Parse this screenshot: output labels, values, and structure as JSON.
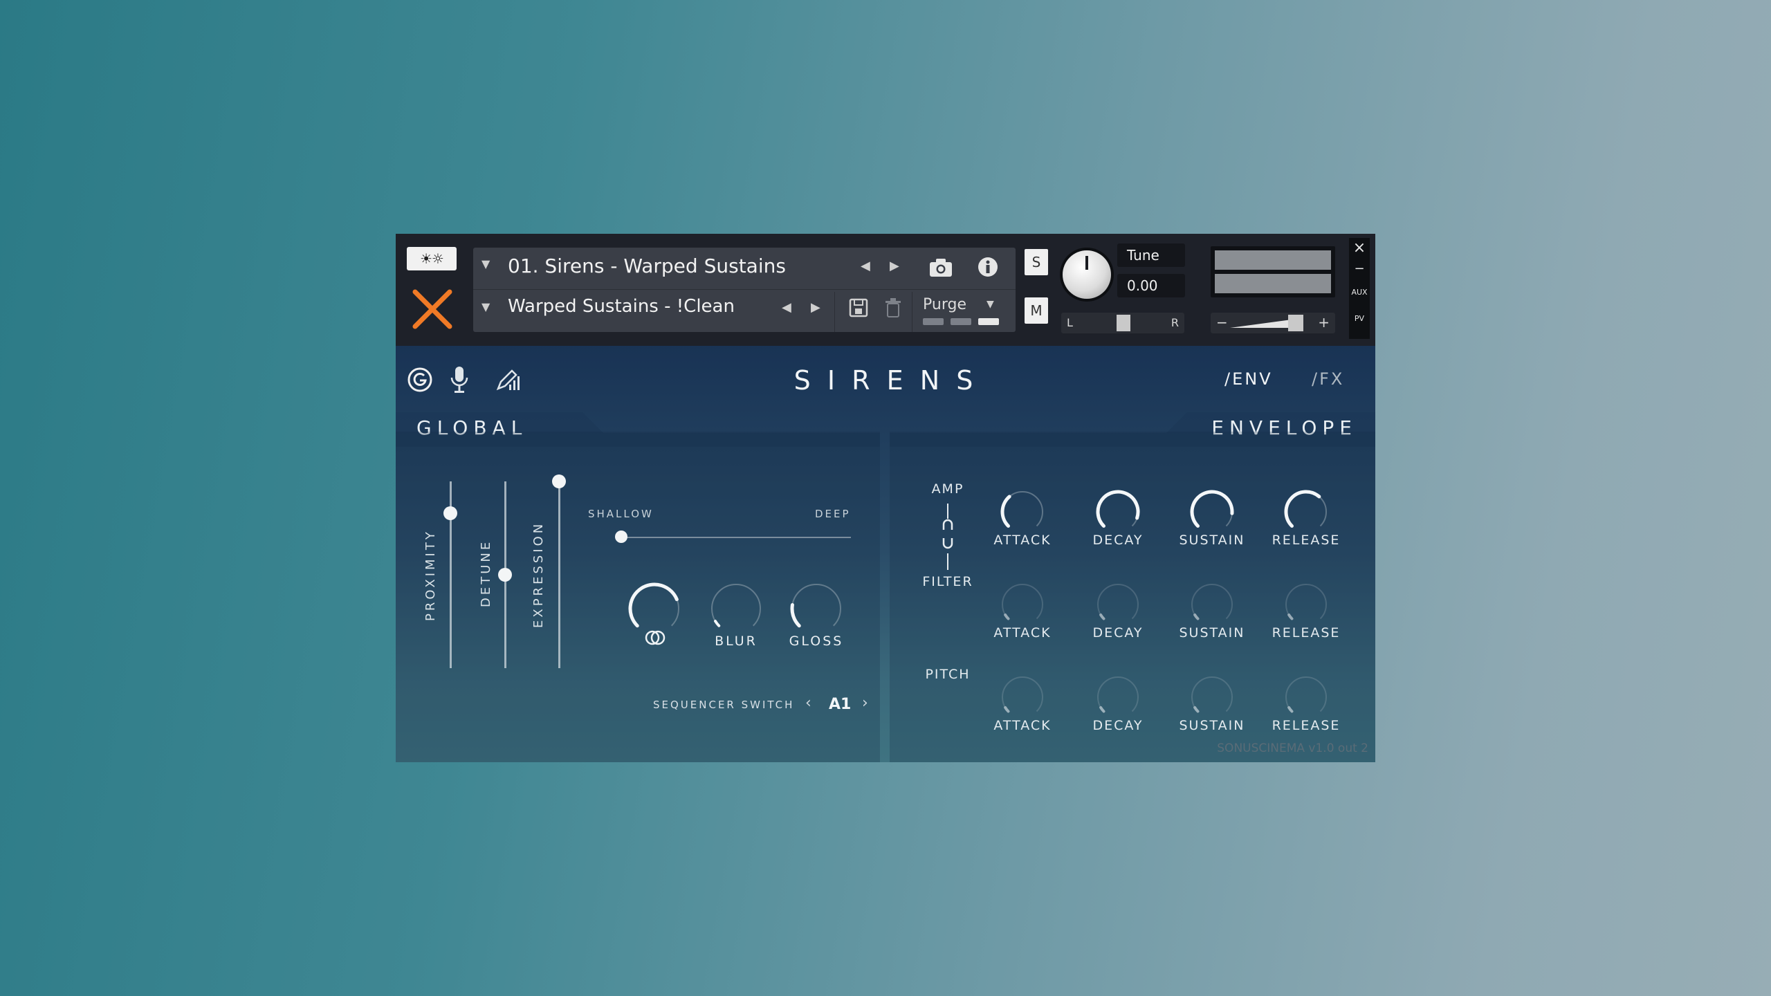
{
  "header": {
    "logo_button": "☀☼",
    "preset_title": "01. Sirens - Warped Sustains",
    "snapshot_name": "Warped Sustains - !Clean",
    "purge_label": "Purge",
    "solo_label": "S",
    "mute_label": "M",
    "tune_label": "Tune",
    "tune_value": "0.00",
    "pan_left": "L",
    "pan_right": "R",
    "vol_minus": "−",
    "vol_plus": "+",
    "aux_label": "AUX",
    "pv_label": "PV",
    "close_label": "×",
    "minimize_label": "−",
    "accent_color": "#f07a26"
  },
  "nav": {
    "title": "S I R E N S",
    "tab_env": "/ENV",
    "tab_fx": "/FX"
  },
  "global": {
    "title": "GLOBAL",
    "faders": [
      {
        "label": "PROXIMITY",
        "value": 0.83
      },
      {
        "label": "DETUNE",
        "value": 0.5
      },
      {
        "label": "EXPRESSION",
        "value": 1.0
      }
    ],
    "shallow_label": "SHALLOW",
    "deep_label": "DEEP",
    "depth_value": 0.0,
    "knobs": [
      {
        "label": "",
        "value": 0.75
      },
      {
        "label": "BLUR",
        "value": 0.0
      },
      {
        "label": "GLOSS",
        "value": 0.2
      }
    ],
    "sequencer_label": "SEQUENCER SWITCH",
    "sequencer_value": "A1"
  },
  "envelope": {
    "title": "ENVELOPE",
    "rows": [
      {
        "name": "AMP",
        "values": [
          0.35,
          0.9,
          0.85,
          0.65
        ]
      },
      {
        "name": "FILTER",
        "values": [
          0,
          0,
          0,
          0
        ]
      },
      {
        "name": "PITCH",
        "values": [
          0,
          0,
          0,
          0
        ]
      }
    ],
    "params": [
      "ATTACK",
      "DECAY",
      "SUSTAIN",
      "RELEASE"
    ]
  },
  "footer": {
    "version": "SONUSCINEMA v1.0 out 2"
  }
}
